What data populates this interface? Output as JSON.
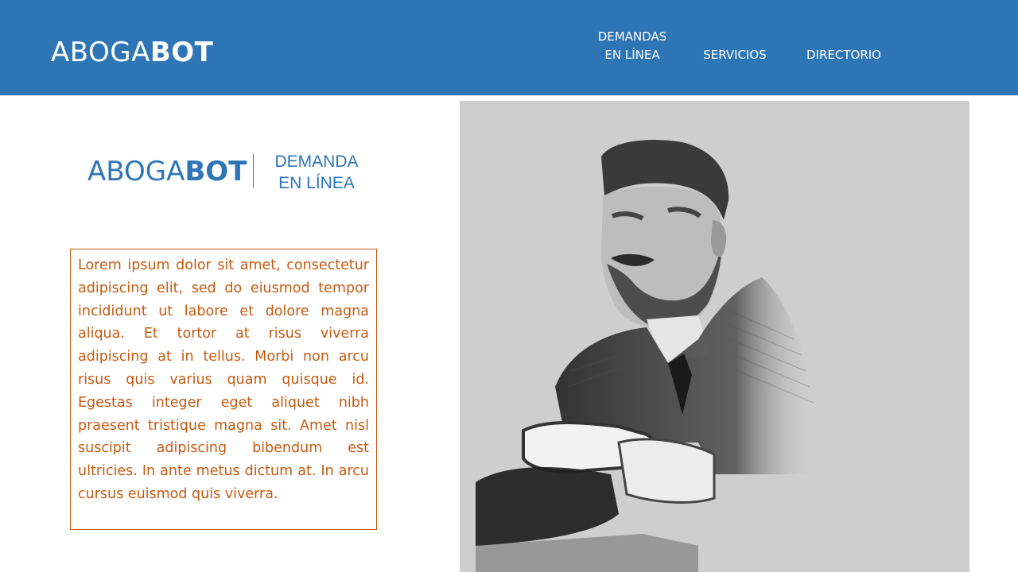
{
  "header": {
    "logo_light": "ABOGA",
    "logo_bold": "BOT",
    "nav": {
      "demandas_line1": "DEMANDAS",
      "demandas_line2": "EN LÍNEA",
      "servicios": "SERVICIOS",
      "directorio": "DIRECTORIO"
    },
    "color": "#2e75b6"
  },
  "brand": {
    "logo_light": "ABOGA",
    "logo_bold": "BOT",
    "tag_line1": "DEMANDA",
    "tag_line2": "EN LÍNEA",
    "color": "#2e75b6"
  },
  "content": {
    "paragraph": "Lorem ipsum dolor sit amet, consectetur adipiscing elit, sed do eiusmod tempor incididunt ut labore et dolore magna aliqua. Et tortor at risus viverra adipiscing at in tellus. Morbi non arcu risus quis varius quam quisque id. Egestas integer eget aliquet nibh praesent tristique magna sit. Amet nisl suscipit adipiscing bibendum est ultricies. In ante metus dictum at. In arcu cursus euismod quis viverra.",
    "color": "#c55a11"
  },
  "image": {
    "icon": "sketch-portrait-man-in-suit",
    "background": "#cecece"
  }
}
